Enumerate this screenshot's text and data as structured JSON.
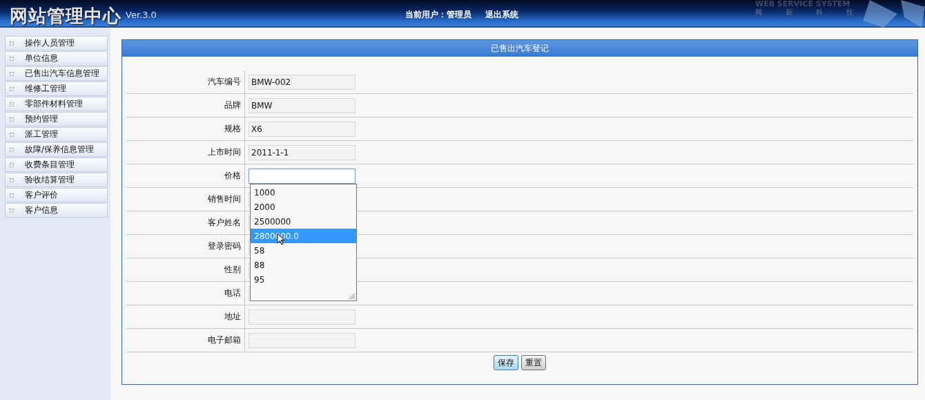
{
  "header": {
    "logo": "网站管理中心",
    "version": "Ver.3.0",
    "tagline": "WEB SERVICE SYSTEM",
    "tagline_sub": "网新科技",
    "user_label": "当前用户：管理员",
    "logout": "退出系统"
  },
  "sidebar": {
    "items": [
      {
        "label": "操作人员管理",
        "selected": false
      },
      {
        "label": "单位信息",
        "selected": false
      },
      {
        "label": "已售出汽车信息管理",
        "selected": false
      },
      {
        "label": "维修工管理",
        "selected": false
      },
      {
        "label": "零部件材料管理",
        "selected": false
      },
      {
        "label": "预约管理",
        "selected": false
      },
      {
        "label": "派工管理",
        "selected": false
      },
      {
        "label": "故障/保养信息管理",
        "selected": false
      },
      {
        "label": "收费条目管理",
        "selected": false
      },
      {
        "label": "验收结算管理",
        "selected": false
      },
      {
        "label": "客户评价",
        "selected": false
      },
      {
        "label": "客户信息",
        "selected": false
      }
    ]
  },
  "panel": {
    "title": "已售出汽车登记",
    "fields": [
      {
        "label": "汽车编号",
        "value": "BMW-002",
        "focused": false
      },
      {
        "label": "品牌",
        "value": "BMW",
        "focused": false
      },
      {
        "label": "规格",
        "value": "X6",
        "focused": false
      },
      {
        "label": "上市时间",
        "value": "2011-1-1",
        "focused": false
      },
      {
        "label": "价格",
        "focused": true
      },
      {
        "label": "销售时间",
        "focused": false
      },
      {
        "label": "客户姓名",
        "focused": false
      },
      {
        "label": "登录密码",
        "focused": false
      },
      {
        "label": "性别",
        "focused": false
      },
      {
        "label": "电话",
        "focused": false
      },
      {
        "label": "地址",
        "focused": false
      },
      {
        "label": "电子邮箱",
        "focused": false
      }
    ],
    "autocomplete": {
      "options": [
        {
          "label": "1000",
          "selected": false
        },
        {
          "label": "2000",
          "selected": false
        },
        {
          "label": "2500000",
          "selected": false
        },
        {
          "label": "2800000.0",
          "selected": true
        },
        {
          "label": "58",
          "selected": false
        },
        {
          "label": "88",
          "selected": false
        },
        {
          "label": "95",
          "selected": false
        }
      ]
    },
    "buttons": [
      {
        "label": "保存",
        "kind": "primary"
      },
      {
        "label": "重置",
        "kind": "default"
      }
    ]
  }
}
